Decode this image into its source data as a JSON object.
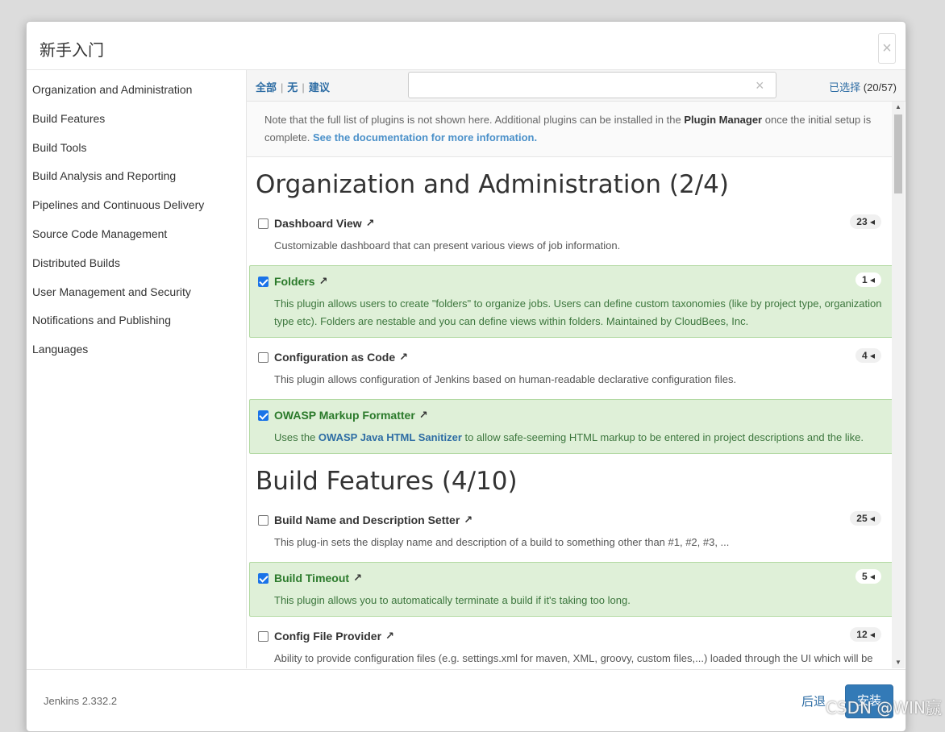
{
  "modal": {
    "title": "新手入门",
    "close_label": "×"
  },
  "sidebar": {
    "items": [
      {
        "label": "Organization and Administration"
      },
      {
        "label": "Build Features"
      },
      {
        "label": "Build Tools"
      },
      {
        "label": "Build Analysis and Reporting"
      },
      {
        "label": "Pipelines and Continuous Delivery"
      },
      {
        "label": "Source Code Management"
      },
      {
        "label": "Distributed Builds"
      },
      {
        "label": "User Management and Security"
      },
      {
        "label": "Notifications and Publishing"
      },
      {
        "label": "Languages"
      }
    ]
  },
  "toolbar": {
    "all": "全部",
    "none": "无",
    "suggested": "建议",
    "sep": "|",
    "search_value": "",
    "search_clear": "×",
    "selected_label": "已选择",
    "selected_count": "(20/57)"
  },
  "note": {
    "text1": "Note that the full list of plugins is not shown here. Additional plugins can be installed in the ",
    "bold": "Plugin Manager",
    "text2": " once the initial setup is complete. ",
    "link": "See the documentation for more information."
  },
  "sections": [
    {
      "title": "Organization and Administration (2/4)",
      "plugins": [
        {
          "name": "Dashboard View",
          "deps": "23",
          "selected": false,
          "desc": "Customizable dashboard that can present various views of job information."
        },
        {
          "name": "Folders",
          "deps": "1",
          "selected": true,
          "desc": "This plugin allows users to create \"folders\" to organize jobs. Users can define custom taxonomies (like by project type, organization type etc). Folders are nestable and you can define views within folders. Maintained by CloudBees, Inc."
        },
        {
          "name": "Configuration as Code",
          "deps": "4",
          "selected": false,
          "desc": "This plugin allows configuration of Jenkins based on human-readable declarative configuration files."
        },
        {
          "name": "OWASP Markup Formatter",
          "deps": "",
          "selected": true,
          "desc_pre": "Uses the ",
          "desc_link": "OWASP Java HTML Sanitizer",
          "desc_post": " to allow safe-seeming HTML markup to be entered in project descriptions and the like."
        }
      ]
    },
    {
      "title": "Build Features (4/10)",
      "plugins": [
        {
          "name": "Build Name and Description Setter",
          "deps": "25",
          "selected": false,
          "desc": "This plug-in sets the display name and description of a build to something other than #1, #2, #3, ..."
        },
        {
          "name": "Build Timeout",
          "deps": "5",
          "selected": true,
          "desc": "This plugin allows you to automatically terminate a build if it's taking too long."
        },
        {
          "name": "Config File Provider",
          "deps": "12",
          "selected": false,
          "desc": "Ability to provide configuration files (e.g. settings.xml for maven, XML, groovy, custom files,...) loaded through the UI which will be copied to the job workspace."
        }
      ]
    }
  ],
  "icons": {
    "external_link": "↗",
    "dep_arrow": "◂"
  },
  "footer": {
    "version": "Jenkins 2.332.2",
    "back": "后退",
    "install": "安装"
  },
  "watermark": "CSDN @WIN赢"
}
